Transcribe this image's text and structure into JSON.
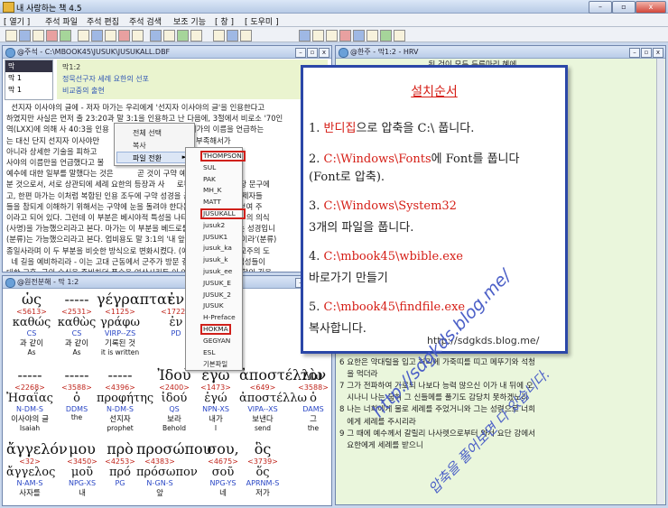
{
  "app": {
    "title": "내 사랑하는 책 4.5"
  },
  "menu": [
    "[ 열기 ]",
    "주석 파일",
    "주석 편집",
    "주석 검색",
    "보조 기능",
    "[ 창 ]",
    "[ 도우미 ]"
  ],
  "window_buttons": {
    "minimize": "–",
    "restore": "▫",
    "close": "x"
  },
  "commentary_panel": {
    "title": "@주석 - C:\\MBOOK45\\JUSUK\\JUSUKALL.DBF",
    "tree_nodes": [
      "막",
      "막 1",
      "막 1"
    ],
    "ref": "막1:2",
    "heading1": "정묵선구자 세례 요한의 선포",
    "heading2": "비교중의 출현",
    "lines": [
      "  선지자 이사야의 글에 - 저자 마가는 우리에게 '선지자 이사야의 글'을 인용한다고",
      "하였지만 사실은 먼저 출 23:20과 말 3:1을 인용하고 난 다음에, 3절에서 비로소 '70인",
      "역(LXX)에 의해 사 40:3을 인용                 의 모세나 엘리가의 이름을 언급하는",
      "는 대신 단지 선지자 이사야만             구약에 대한 이해가  부족해서가",
      "아니라 상세한 기술을 피하고              독에 따라 그 대표적 인물로서 이",
      "사야의 이름만을 언급했다고 볼           정선자 요한이 메시야의 길을 여는",
      "예수에 대한 일부를 말했다는 것은          곧 것이 구약 예언의 성취이심을",
      "분 것으로서, 서로 상관되에 세례 요한의 등장과 사     로부터 나오기 전 가장 문구에",
      "고, 한편 마가는 이처럼 복합된 인용 조두에 구약 성경을 근거로 사계의 복  제자들",
      "들을 참되게 이해하기 위해서는 구약에 눈을 돌려야 한다는 사실을 더불어 보여 주",
      "이라고 되어 있다. 그런데 이 부분은 베시야적 특성을 나타내는 설명으로 이  의 의식",
      "(사명)을 가능했으리라고 본다. 마가는 이 부분을 베드로를 통해 보로 만드는 성경입니",
      "(분류)는 가능했으리라고 본다. 업비용도 말 3:1의 '내 앞에 길을 예비할 것이라'(분류)",
      "종일사라며 이 두 부분을 비슷한 방식으로 변화시켰다. (예 '나사렛 출신 불교주의 도",
      "  네 길을 예비하리라 - 이는 고대 근동에서 군주가 방문 길을 위해 나서면 백성들이",
      "대한 교훈, 군의 숙식을 준비하던 풍습을 연상시키듯 이 여정도 선지자의 역할의 길을",
      "하고 포장 '하는 무엇이 있었다. 여기서 '네 길', 즉 거론의 길은 너의 길을 예시하",
      "잠이 되시는 예수의 등장에 앞서 지금것 간행되어 온 세례가 요한이 선포할 필요성",
      "이라가 먼어아 하는 이 이 대사를 이 대사의 길 따라 이르는 설명이 되리라는 것을"
    ]
  },
  "context_menu": {
    "items": [
      "전체 선택",
      "복사",
      "파일 전환"
    ],
    "arrow": "►"
  },
  "submenu": {
    "items": [
      "THOMPSON",
      "SUL",
      "PAK",
      "MH_K",
      "MATT",
      "JUSUKALL",
      "jusuk2",
      "JUSUK1",
      "jusuk_ka",
      "jusuk_k",
      "jusuk_ee",
      "JUSUK_E",
      "JUSUK_2",
      "JUSUK",
      "H-Preface",
      "HOKMA",
      "GEGYAN",
      "ESL",
      "기본파일"
    ],
    "highlighted": [
      "THOMPSON",
      "JUSUKALL",
      "HOKMA"
    ]
  },
  "hrv_panel": {
    "title": "@한주 - 막1:2 - HRV",
    "lines": [
      "                                    된 것이 모두 두루마리 혜에",
      "",
      "                                      그 나 내 앞에서 길을 예",
      "                                      미디 곧 너희의 사로하는",
      "",
      "                                      네 길을 네 앞에 예비하",
      "",
      "                                      따는 그 사람에게 화가",
      "                                      로 인용하나니라.",
      "",
      "                                      나 나를 배리라라 기록된",
      "",
      "                                      아니하며 모태로부터",
      "",
      "                                      이 백성의 마음을 자식에게,",
      "                                      준비된 백성을 주께로 돌아",
      "",
      "                                    앞에 보내노",
      "",
      "                                        주 의 길을",
      "                                      감 같이",
      "                                      하는 회개의",
      "   세례를 전하",
      "5 온 유대 지     루살렘 사람이 다 나아가 자기 죄를 자복",
      "   하고 요단강에서 그에게 세례를 받더라.",
      "6 요한은 약대털을 입고 허리에 가죽띠를 띠고 메뚜기와 석청",
      "   을 먹더라",
      "7 그가 전파하여 가로되 나보다 능력 많으신 이가 내 뒤에 오",
      "   시나니 나는 굽혀 그 신들메를 풀기도 감당치 못하겠노라",
      "8 나는 너희에게 물로 세례를 주었거니와 그는 성령으로 너희",
      "   에게 세례를 주시리라",
      "9 그 때에 예수께서 갈릴리 나사렛으로부터 와서 요단 강에서",
      "   요한에게 세례를 받으니"
    ]
  },
  "greek_panel": {
    "title": "@원전분해 - 막 1:2",
    "rows": [
      [
        {
          "word": "ὡς",
          "num": "<5613>",
          "lemma": "καθώς",
          "parse": "CS",
          "kor": "과 같이",
          "eng": "As"
        },
        {
          "word": "-----",
          "num": "<2531>",
          "lemma": "καθὼς",
          "parse": "CS",
          "kor": "과 같이",
          "eng": "As"
        },
        {
          "word": "γέγραπται",
          "num": "<1125>",
          "lemma": "γράφω",
          "parse": "VIRP--ZS",
          "kor": "기록된 것",
          "eng": "it is written"
        },
        {
          "word": "ἐν",
          "num": "<1722>",
          "lemma": "ἐν",
          "parse": "PD",
          "kor": "",
          "eng": ""
        },
        {
          "word": "τ",
          "num": "<3588>",
          "lemma": "ὁ",
          "parse": "DDMS",
          "kor": "",
          "eng": ""
        }
      ],
      [
        {
          "word": "-----",
          "num": "<2268>",
          "lemma": "Ἠσαΐας",
          "parse": "N-DM-S",
          "kor": "이사야의 글",
          "eng": "Isaiah"
        },
        {
          "word": "-----",
          "num": "<3588>",
          "lemma": "ὁ",
          "parse": "DDMS",
          "kor": "",
          "eng": "the"
        },
        {
          "word": "-----",
          "num": "<4396>",
          "lemma": "προφήτης",
          "parse": "N-DM-S",
          "kor": "선지자",
          "eng": "prophet"
        },
        {
          "word": "Ἰδοὺ",
          "num": "<2400>",
          "lemma": "ἰδού",
          "parse": "QS",
          "kor": "보라",
          "eng": "Behold"
        },
        {
          "word": "ἐγὼ",
          "num": "<1473>",
          "lemma": "ἐγώ",
          "parse": "NPN-XS",
          "kor": "내가",
          "eng": "I"
        },
        {
          "word": "ἀποστέλλω",
          "num": "<649>",
          "lemma": "ἀποστέλλω",
          "parse": "VIPA--XS",
          "kor": "보낸다",
          "eng": "send"
        },
        {
          "word": "τὸν",
          "num": "<3588>",
          "lemma": "ὁ",
          "parse": "DAMS",
          "kor": "그",
          "eng": "the"
        }
      ],
      [
        {
          "word": "ἄγγελόν",
          "num": "<32>",
          "lemma": "ἄγγελος",
          "parse": "N-AM-S",
          "kor": "사자를",
          "eng": ""
        },
        {
          "word": "μου",
          "num": "<3450>",
          "lemma": "μοῦ",
          "parse": "NPG-XS",
          "kor": "내",
          "eng": ""
        },
        {
          "word": "πρὸ",
          "num": "<4253>",
          "lemma": "πρό",
          "parse": "PG",
          "kor": "",
          "eng": ""
        },
        {
          "word": "προσώπου",
          "num": "<4383>",
          "lemma": "πρόσωπον",
          "parse": "N-GN-S",
          "kor": "앞",
          "eng": ""
        },
        {
          "word": "σου,",
          "num": "<4675>",
          "lemma": "σοῦ",
          "parse": "NPG-YS",
          "kor": "네",
          "eng": ""
        },
        {
          "word": "ὃς",
          "num": "<3739>",
          "lemma": "ὅς",
          "parse": "APRNM-S",
          "kor": "저가",
          "eng": ""
        }
      ]
    ]
  },
  "instructions": {
    "title": "설치순서",
    "steps": [
      {
        "pre": "1. ",
        "red": "반디집",
        "post": "으로 압축을 C:\\ 풉니다."
      },
      {
        "pre": "2. ",
        "red": "C:\\Windows\\Fonts",
        "post": "에 Font를 풉니다"
      },
      {
        "pre": "",
        "red": "",
        "post": "(Font로 압축)."
      },
      {
        "pre": "3. ",
        "red": "C:\\Windows\\System32",
        "post": ""
      },
      {
        "pre": "    3개의 파일을 풉니다.",
        "red": "",
        "post": ""
      },
      {
        "pre": "4. ",
        "red": "C:\\mbook45\\wbible.exe",
        "post": ""
      },
      {
        "pre": " 바로가기 만들기",
        "red": "",
        "post": ""
      },
      {
        "pre": "5. ",
        "red": "C:\\mbook45\\findfile.exe",
        "post": ""
      },
      {
        "pre": " 복사합니다.",
        "red": "",
        "post": ""
      }
    ]
  },
  "watermarks": {
    "url_small": "http://sdgkds.blog.me/",
    "url_diag": "http://sdgkds.blog.me/",
    "note": "압축을 풀어보면 다 있습니다."
  }
}
